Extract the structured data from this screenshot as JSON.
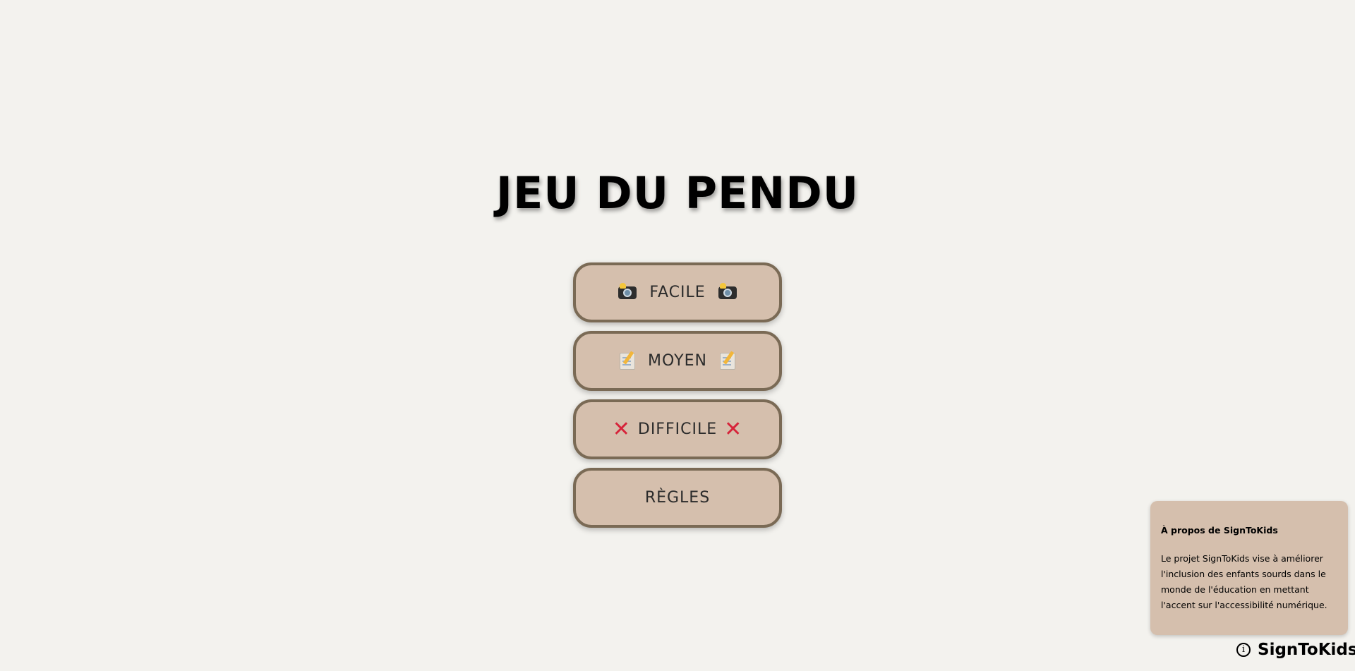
{
  "page": {
    "title": "JEU DU PENDU"
  },
  "menu": {
    "items": [
      {
        "label": "FACILE",
        "icon": "camera-flash-icon"
      },
      {
        "label": "MOYEN",
        "icon": "memo-icon"
      },
      {
        "label": "DIFFICILE",
        "icon": "cross-mark-icon"
      },
      {
        "label": "RÈGLES",
        "icon": ""
      }
    ]
  },
  "about": {
    "title": "À propos de SignToKids",
    "text": "Le projet SignToKids vise à améliorer l'inclusion des enfants sourds dans le monde de l'éducation en mettant l'accent sur l'accessibilité numérique."
  },
  "brand": {
    "name": "SignToKids",
    "info_glyph": "i"
  },
  "colors": {
    "background": "#f3f2ee",
    "button_fill": "#d5bfad",
    "button_border": "#7a6a55",
    "cross": "#d6243a"
  }
}
